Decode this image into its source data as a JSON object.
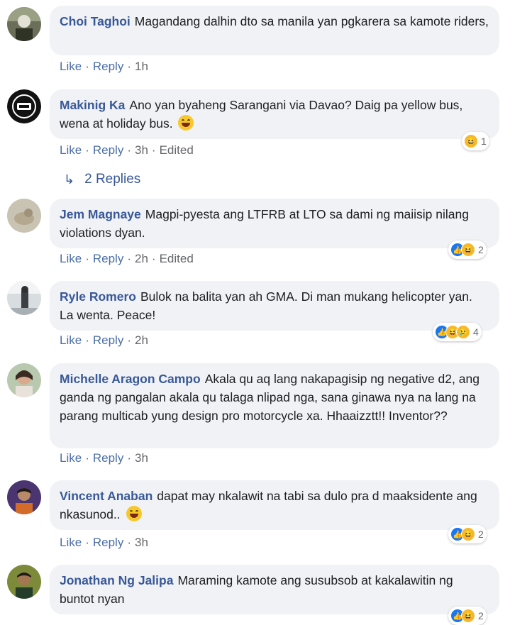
{
  "comments": [
    {
      "author": "Choi Taghoi",
      "text": "Magandang dalhin dto sa manila yan pgkarera sa kamote riders,",
      "like": "Like",
      "reply": "Reply",
      "time": "1h",
      "edited": "",
      "reaction_count": "",
      "avatar_icon": "person-avatar-icon"
    },
    {
      "author": "Makinig Ka",
      "text": "Ano yan byaheng Sarangani via Davao? Daig pa yellow bus, wena at holiday bus.",
      "like": "Like",
      "reply": "Reply",
      "time": "3h",
      "edited": "Edited",
      "reaction_count": "1",
      "avatar_icon": "logo-avatar-icon"
    },
    {
      "author": "Jem Magnaye",
      "text": "Magpi-pyesta ang LTFRB at LTO sa dami ng maiisip nilang violations dyan.",
      "like": "Like",
      "reply": "Reply",
      "time": "2h",
      "edited": "Edited",
      "reaction_count": "2",
      "avatar_icon": "photo-avatar-icon"
    },
    {
      "author": "Ryle Romero",
      "text": "Bulok na balita yan ah GMA. Di man mukang helicopter yan. La wenta. Peace!",
      "like": "Like",
      "reply": "Reply",
      "time": "2h",
      "edited": "",
      "reaction_count": "4",
      "avatar_icon": "photo-avatar-icon"
    },
    {
      "author": "Michelle Aragon Campo",
      "text": "Akala qu aq lang nakapagisip ng negative d2, ang ganda ng pangalan akala qu talaga nlipad nga, sana ginawa nya na lang na parang multicab yung design pro motorcycle xa. Hhaaizztt!! Inventor??",
      "like": "Like",
      "reply": "Reply",
      "time": "3h",
      "edited": "",
      "reaction_count": "",
      "avatar_icon": "person-avatar-icon"
    },
    {
      "author": "Vincent Anaban",
      "text": "dapat may nkalawit na tabi sa dulo pra d maaksidente ang nkasunod..",
      "like": "Like",
      "reply": "Reply",
      "time": "3h",
      "edited": "",
      "reaction_count": "2",
      "avatar_icon": "person-avatar-icon"
    },
    {
      "author": "Jonathan Ng Jalipa",
      "text": "Maraming kamote ang susubsob at kakalawitin ng buntot nyan",
      "like": "",
      "reply": "",
      "time": "",
      "edited": "",
      "reaction_count": "2",
      "avatar_icon": "person-avatar-icon"
    }
  ],
  "replies_link": "2 Replies",
  "colors": {
    "bubble": "#f0f2f5",
    "author": "#385898",
    "link": "#4b6ea8",
    "like_reaction": "#1877f2",
    "haha_reaction": "#f7b928"
  }
}
